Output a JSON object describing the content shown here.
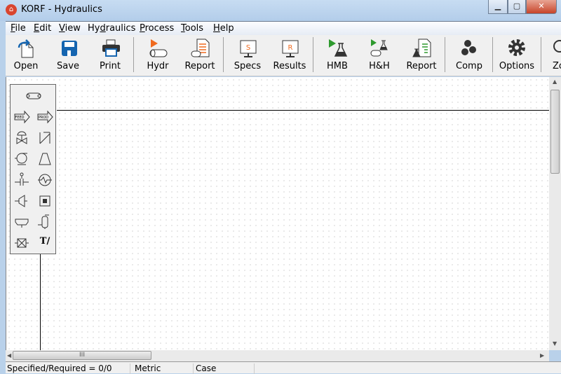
{
  "window": {
    "title": "KORF - Hydraulics",
    "minimize": "▁",
    "maximize": "▢",
    "close": "✕"
  },
  "menu": [
    {
      "label": "File",
      "key": "F",
      "rest": "ile"
    },
    {
      "label": "Edit",
      "key": "E",
      "rest": "dit"
    },
    {
      "label": "View",
      "key": "V",
      "rest": "iew"
    },
    {
      "label": "Hydraulics",
      "pre": "Hy",
      "key": "d",
      "rest": "raulics"
    },
    {
      "label": "Process",
      "key": "P",
      "rest": "rocess"
    },
    {
      "label": "Tools",
      "key": "T",
      "rest": "ools"
    },
    {
      "label": "Help",
      "key": "H",
      "rest": "elp"
    }
  ],
  "toolbar": {
    "open": "Open",
    "save": "Save",
    "print": "Print",
    "hydr": "Hydr",
    "report1": "Report",
    "specs": "Specs",
    "specs_glyph": "S",
    "results": "Results",
    "results_glyph": "R",
    "hmb": "HMB",
    "hh": "H&H",
    "report2": "Report",
    "comp": "Comp",
    "options": "Options",
    "zoom": "Zo"
  },
  "palette": {
    "text_tool": "T/",
    "feed": "FEED",
    "prod": "PROD"
  },
  "colors": {
    "orange": "#f06a1e",
    "green": "#2e9a2e",
    "blue": "#1565b0"
  },
  "hscroll": {
    "grip": "III"
  },
  "status": {
    "specified": "Specified/Required = 0/0",
    "units": "Metric",
    "case": "Case"
  }
}
